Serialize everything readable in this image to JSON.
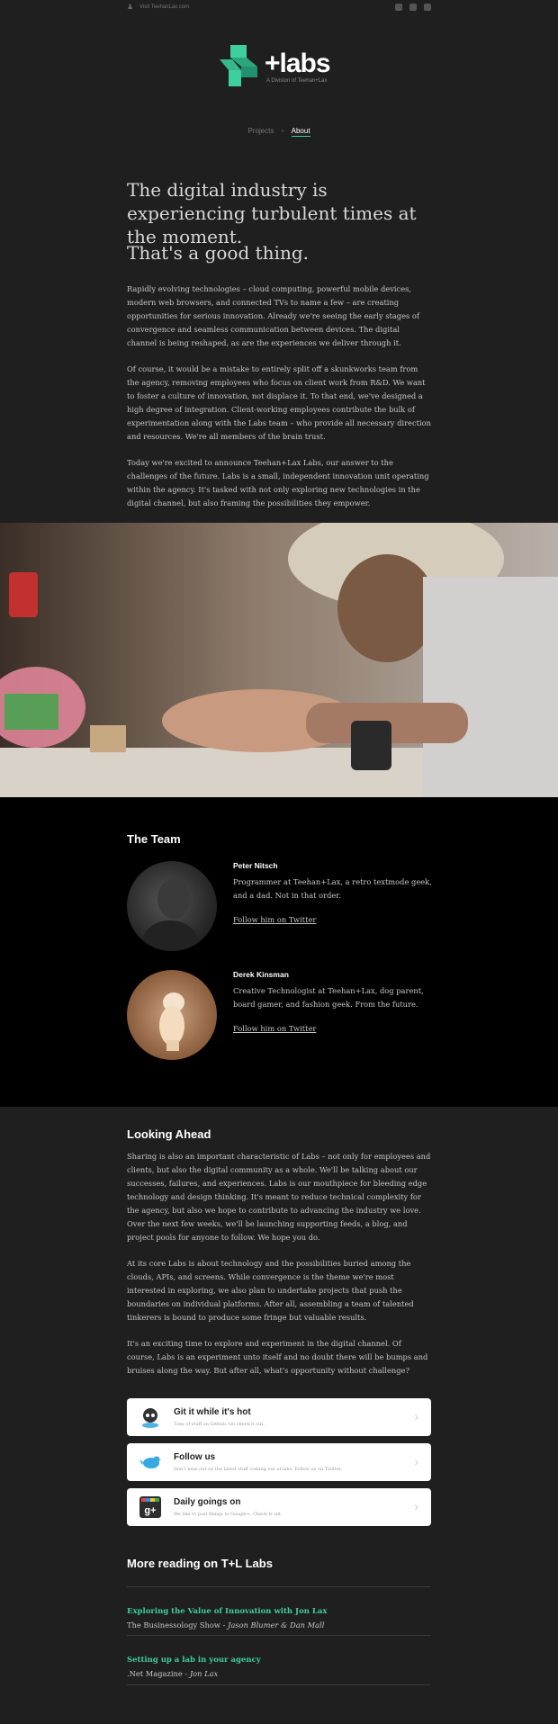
{
  "topbar": {
    "visit_label": "Visit TeehanLax.com",
    "social_icons": [
      "twitter-icon",
      "dribbble-icon",
      "github-icon"
    ]
  },
  "brand": {
    "name": "+labs",
    "tagline": "A Division of Teehan+Lax",
    "accent": "#3ecf9e"
  },
  "nav": {
    "items": [
      "Projects",
      "About"
    ],
    "separator": "•",
    "active": "About"
  },
  "intro": {
    "headline": "The digital industry is experiencing turbulent times at the moment.",
    "subheadline": "That's a good thing.",
    "paragraphs": [
      "Rapidly evolving technologies – cloud computing, powerful mobile devices, modern web browsers, and connected TVs to name a few – are creating opportunities for serious innovation. Already we're seeing the early stages of convergence and seamless communication between devices. The digital channel is being reshaped, as are the experiences we deliver through it.",
      "Of course, it would be a mistake to entirely split off a skunkworks team from the agency, removing employees who focus on client work from R&D. We want to foster a culture of innovation, not displace it. To that end, we've designed a high degree of integration. Client-working employees contribute the bulk of experimentation along with the Labs team – who provide all necessary direction and resources. We're all members of the brain trust.",
      "Today we're excited to announce Teehan+Lax Labs, our answer to the challenges of the future. Labs is a small, independent innovation unit operating within the agency. It's tasked with not only exploring new technologies in the digital channel, but also framing the possibilities they empower."
    ]
  },
  "team": {
    "title": "The Team",
    "members": [
      {
        "name": "Peter Nitsch",
        "bio": "Programmer at Teehan+Lax, a retro textmode geek, and a dad. Not in that order.",
        "link": "Follow him on Twitter"
      },
      {
        "name": "Derek Kinsman",
        "bio": "Creative Technologist at Teehan+Lax, dog parent, board gamer, and fashion geek. From the future.",
        "link": "Follow him on Twitter"
      }
    ]
  },
  "looking_ahead": {
    "title": "Looking Ahead",
    "paragraphs": [
      "Sharing is also an important characteristic of Labs – not only for employees and clients, but also the digital community as a whole. We'll be talking about our successes, failures, and experiences. Labs is our mouthpiece for bleeding edge technology and design thinking. It's meant to reduce technical complexity for the agency, but also we hope to contribute to advancing the industry we love. Over the next few weeks, we'll be launching supporting feeds, a blog, and project pools for anyone to follow. We hope you do.",
      "At its core Labs is about technology and the possibilities buried among the clouds, APIs, and screens. While convergence is the theme we're most interested in exploring, we also plan to undertake projects that push the boundaries on individual platforms. After all, assembling a team of talented tinkerers is bound to produce some fringe but valuable results.",
      "It's an exciting time to explore and experiment in the digital channel. Of course, Labs is an experiment unto itself and no doubt there will be bumps and bruises along the way. But after all, what's opportunity without challenge?"
    ]
  },
  "cards": [
    {
      "title": "Git it while it's hot",
      "sub": "Tons of stuff on Github. Go check it out.",
      "icon": "github-octocat-icon"
    },
    {
      "title": "Follow us",
      "sub": "Don't miss out on the latest stuff coming out of labs. Follow us on Twitter.",
      "icon": "twitter-bird-icon"
    },
    {
      "title": "Daily goings on",
      "sub": "We like to post things to Google+. Check it out.",
      "icon": "google-plus-icon"
    }
  ],
  "reading": {
    "title": "More reading on T+L Labs",
    "items": [
      {
        "title": "Exploring the Value of Innovation with Jon Lax",
        "source": "The Businessology Show",
        "authors": "Jason Blumer & Dan Mall"
      },
      {
        "title": "Setting up a lab in your agency",
        "source": ".Net Magazine",
        "authors": "Jon Lax"
      }
    ]
  }
}
